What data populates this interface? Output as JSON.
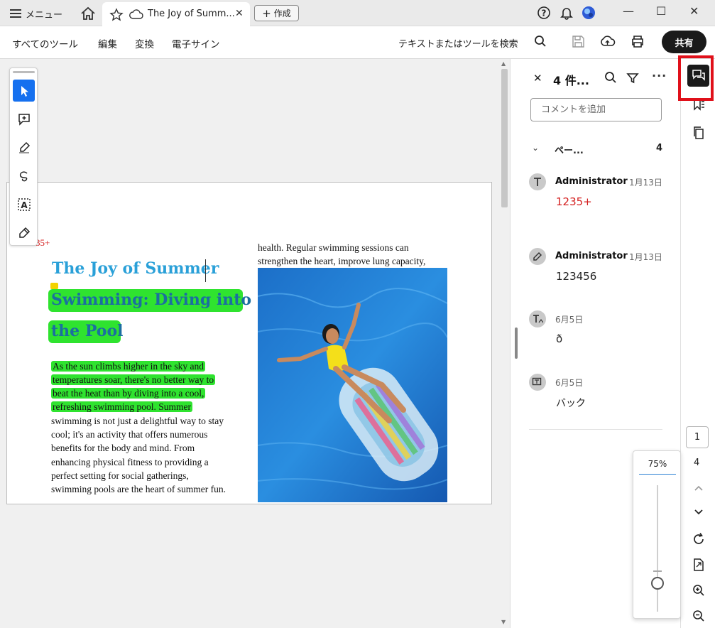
{
  "titlebar": {
    "menu_label": "メニュー",
    "tab_title": "The Joy of Summ...",
    "new_label": "作成"
  },
  "toolbar": {
    "items": [
      "すべてのツール",
      "編集",
      "変換",
      "電子サイン"
    ],
    "search_label": "テキストまたはツールを検索",
    "share_label": "共有"
  },
  "document": {
    "red_fragment": "35+",
    "title_line1": "The Joy of Summer",
    "title_line2": "Swimming: Diving into",
    "title_line3": "the Pool",
    "body_lines_highlighted": [
      "As the sun climbs higher in the sky and",
      "temperatures soar, there's no better way to",
      "beat the heat than by diving into a cool,",
      "refreshing swimming pool. Summer"
    ],
    "body_lines": [
      "swimming is not just a delightful way to stay",
      "cool; it's an activity that offers numerous",
      "benefits for the body and mind. From",
      "enhancing physical fitness to providing a",
      "perfect setting for social gatherings,",
      "swimming pools are the heart of summer fun."
    ],
    "col2_lines": [
      "health. Regular swimming sessions can",
      "strengthen the heart, improve lung capacity,"
    ]
  },
  "comments_panel": {
    "count_label": "4 件...",
    "add_placeholder": "コメントを追加",
    "group_label": "ペー...",
    "group_count": "4",
    "comments": [
      {
        "author": "Administrator",
        "date": "1月13日",
        "text": "1235+",
        "text_color": "#d42020",
        "icon": "text-comment-icon"
      },
      {
        "author": "Administrator",
        "date": "1月13日",
        "text": "123456",
        "text_color": "#222222",
        "icon": "highlight-pen-icon"
      },
      {
        "author": "",
        "date": "6月5日",
        "text": "ð",
        "text_color": "#222222",
        "icon": "text-insert-icon"
      },
      {
        "author": "",
        "date": "6月5日",
        "text": "バック",
        "text_color": "#222222",
        "icon": "textbox-comment-icon"
      }
    ]
  },
  "navigation": {
    "current_page": "1",
    "total_pages": "4"
  },
  "zoom": {
    "value_label": "75%"
  },
  "colors": {
    "accent": "#1570ef",
    "highlight": "#2fe32f",
    "title_blue": "#2aa0d8",
    "redbox": "#e0101a"
  }
}
